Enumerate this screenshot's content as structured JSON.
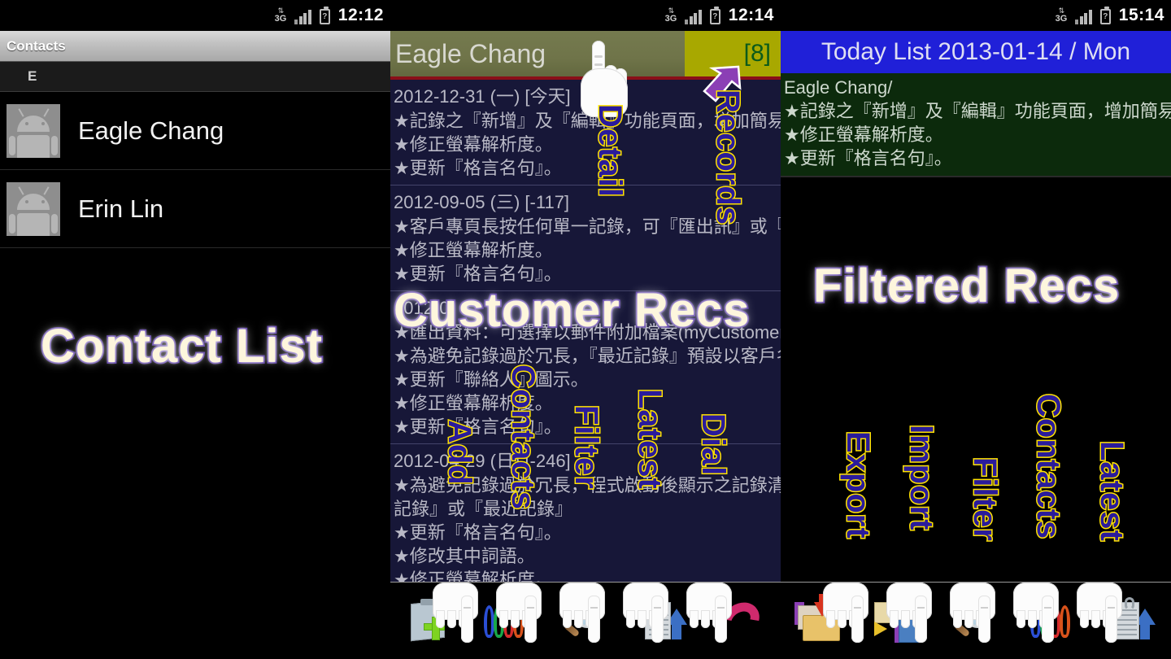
{
  "meta": {
    "overall": "Three Android phone screenshots side by side with annotation callouts"
  },
  "panels": {
    "left": {
      "statusbar": {
        "network": "3G",
        "signal_icon": "signal-bars",
        "battery_icon": "battery-unknown",
        "clock": "12:12"
      },
      "titlebar": {
        "title": "Contacts"
      },
      "section_header": "E",
      "contacts": [
        {
          "name": "Eagle Chang",
          "avatar": "android-avatar"
        },
        {
          "name": "Erin Lin",
          "avatar": "android-avatar"
        }
      ],
      "callout": "Contact List"
    },
    "middle": {
      "statusbar": {
        "network": "3G",
        "signal_icon": "signal-bars",
        "battery_icon": "battery-unknown",
        "clock": "12:14"
      },
      "header": {
        "customer": "Eagle Chang",
        "count_badge": "[8]"
      },
      "records": [
        {
          "date": "2012-12-31 (一) [今天]",
          "lines": [
            "★記錄之『新增』及『編輯』功能頁面，增加簡易日",
            "★修正螢幕解析度。",
            "★更新『格言名句』。"
          ]
        },
        {
          "date": "2012-09-05 (三) [-117]",
          "lines": [
            "★客戶專頁長按任何單一記錄，可『匯出訊』或『",
            "★修正螢幕解析度。",
            "★更新『格言名句』。"
          ]
        },
        {
          "date": "2012-0",
          "lines": [
            "★匯出資料：可選擇以郵件附加檔案(myCustomer.z",
            "★為避免記錄過於冗長，『最近記錄』預設以客戶名",
            "★更新『聯絡人』圖示。",
            "★修正螢幕解析度。",
            "★更新『格言名句』。"
          ]
        },
        {
          "date": "2012-04-29 (日) [-246]",
          "lines": [
            "★為避免記錄過於冗長，程式啟動後顯示之記錄清單",
            "記錄』或『最近記錄』",
            "★更新『格言名句』。",
            "★修改其中詞語。",
            "★修正螢幕解析度。"
          ]
        }
      ],
      "callout": "Customer Recs",
      "pointer_labels": {
        "detail": "Detail",
        "records": "Records"
      },
      "toolbar": [
        {
          "label": "Add",
          "icon": "add-record-icon"
        },
        {
          "label": "Contacts",
          "icon": "contacts-icon"
        },
        {
          "label": "Filter",
          "icon": "magnifier-icon"
        },
        {
          "label": "Latest",
          "icon": "latest-doc-icon"
        },
        {
          "label": "Dial",
          "icon": "phone-handset-icon"
        }
      ]
    },
    "right": {
      "statusbar": {
        "network": "3G",
        "signal_icon": "signal-bars",
        "battery_icon": "battery-unknown",
        "clock": "15:14"
      },
      "header": {
        "title": "Today List 2013-01-14 / Mon"
      },
      "entry": {
        "who": "Eagle Chang/",
        "lines": [
          "★記錄之『新增』及『編輯』功能頁面，增加簡易日",
          "★修正螢幕解析度。",
          "★更新『格言名句』。"
        ]
      },
      "callout": "Filtered Recs",
      "toolbar": [
        {
          "label": "Export",
          "icon": "export-folder-icon"
        },
        {
          "label": "Import",
          "icon": "import-folder-icon"
        },
        {
          "label": "Filter",
          "icon": "magnifier-icon"
        },
        {
          "label": "Contacts",
          "icon": "contacts-icon"
        },
        {
          "label": "Latest",
          "icon": "latest-doc-icon"
        }
      ]
    }
  },
  "colors": {
    "callout_fill": "#fdf6dd",
    "callout_stroke": "#4b2a9c",
    "vlabel_fill": "#2a1b9c",
    "vlabel_stroke": "#ffe200",
    "middle_header_bg": "#6f7449",
    "count_badge_bg": "#a8a800",
    "count_badge_fg": "#0a5a1a",
    "middle_body_bg": "#171738",
    "today_header_bg": "#2020d8",
    "today_body_bg": "#0c2a0c",
    "arrow_purple": "#8b3fb5",
    "red_divider": "#8a0f18"
  }
}
